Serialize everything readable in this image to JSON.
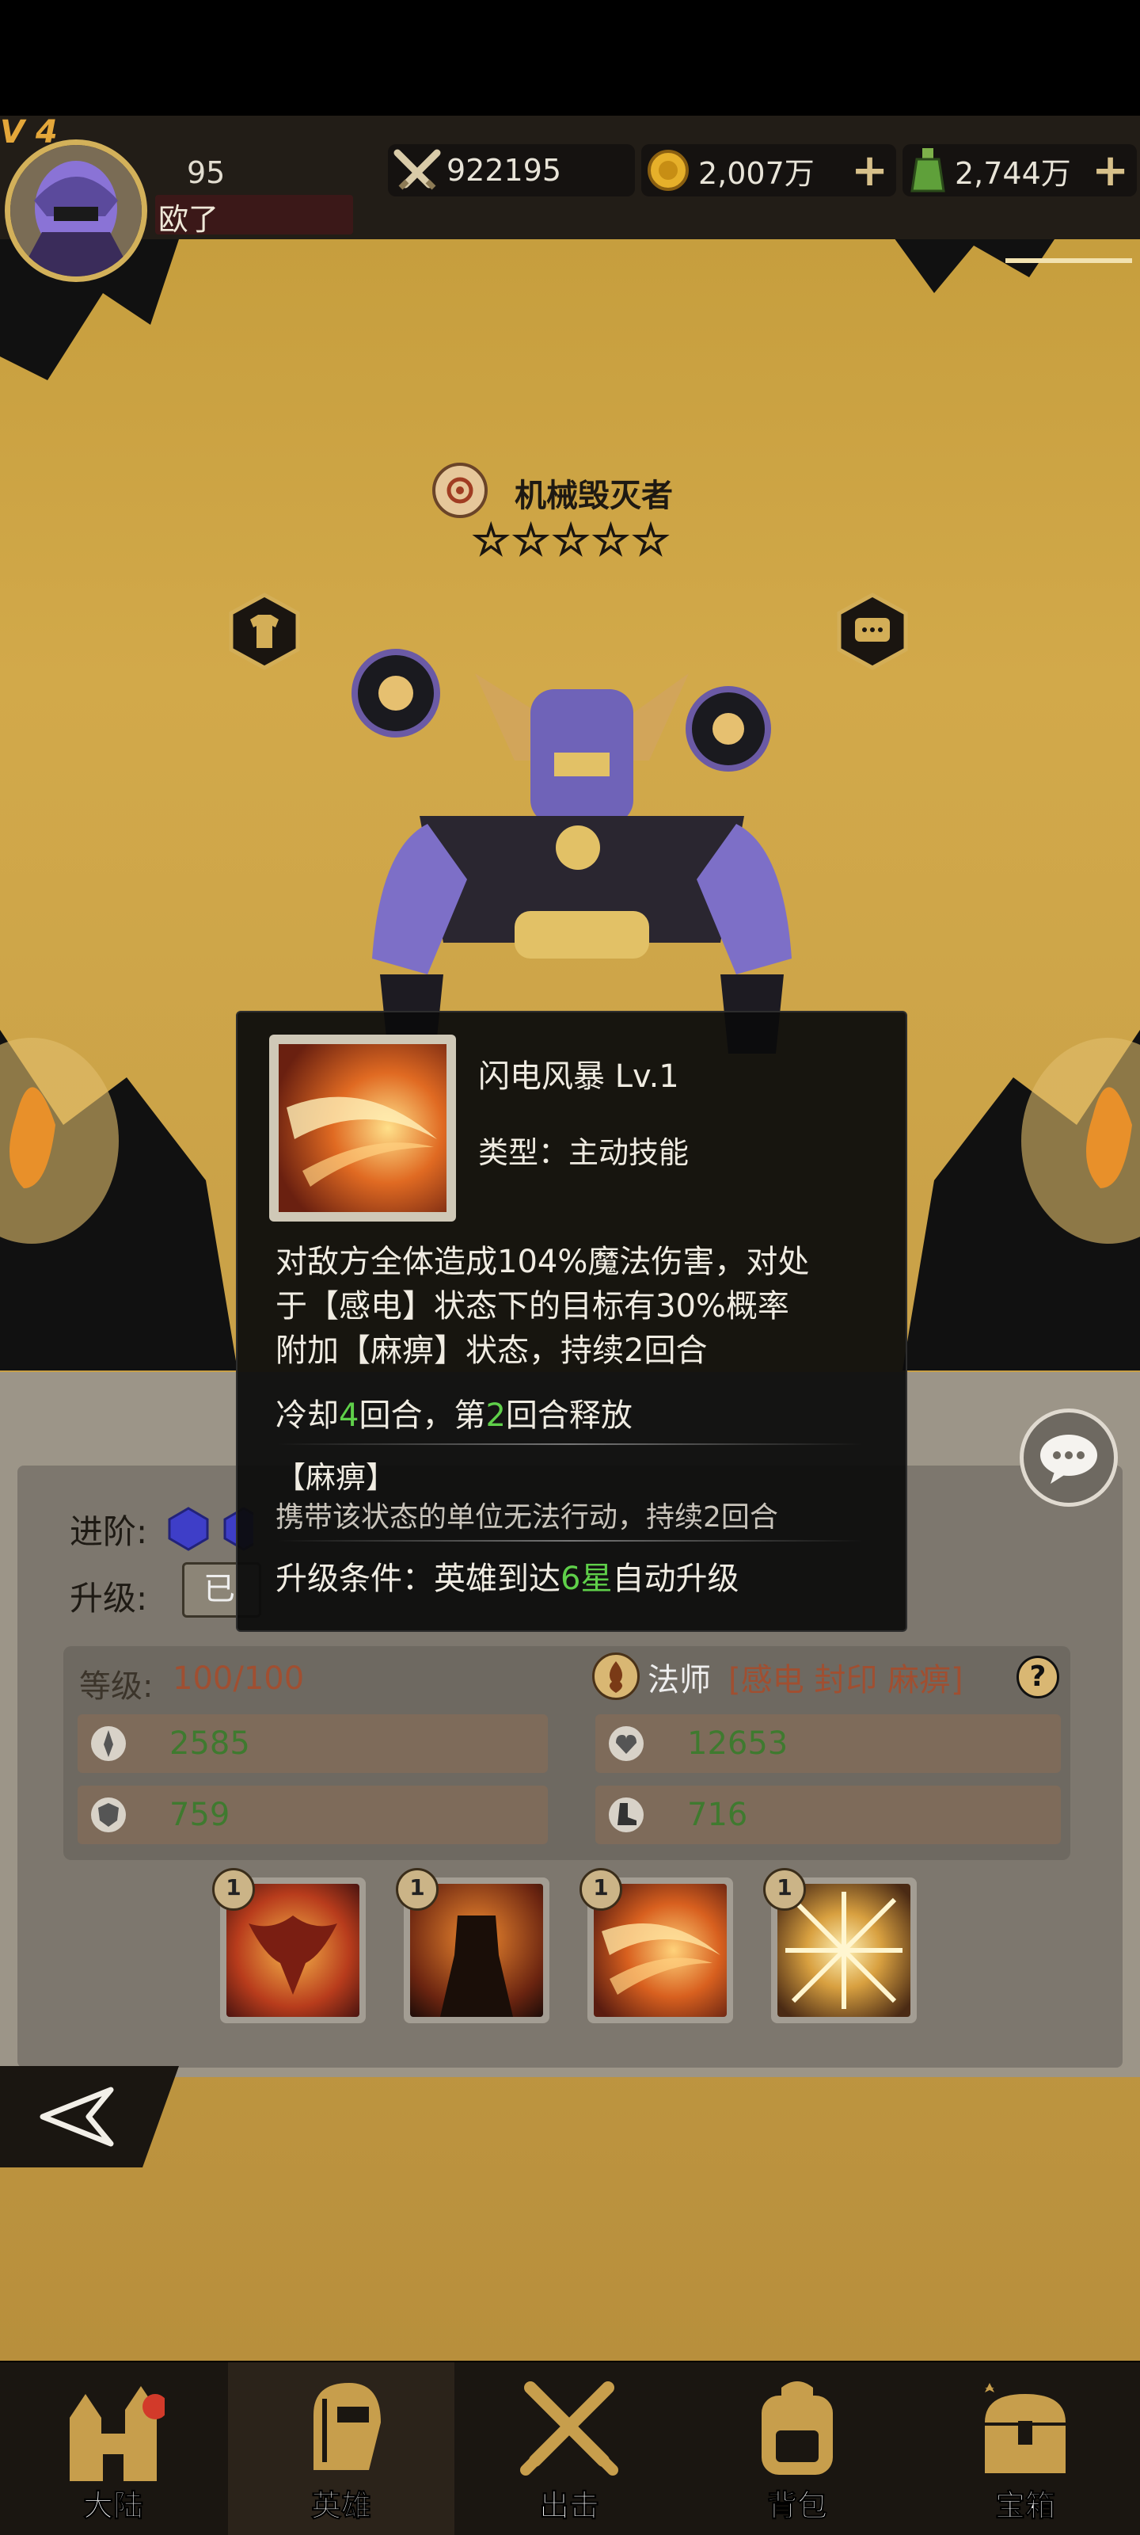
{
  "hud": {
    "level_tag": "V 4",
    "player_level": "95",
    "player_name": "欧了",
    "power": "922195",
    "gold": "2,007万",
    "potion": "2,744万"
  },
  "hero": {
    "name": "机械毁灭者",
    "stars": 5
  },
  "tooltip": {
    "skill_name": "闪电风暴 Lv.1",
    "type_label": "类型：主动技能",
    "desc_line1": "对敌方全体造成104%魔法伤害，对处",
    "desc_line2": "于【感电】状态下的目标有30%概率",
    "desc_line3": "附加【麻痹】状态，持续2回合",
    "cd_prefix": "冷却",
    "cd_turns": "4",
    "cd_mid": "回合，第",
    "cd_release": "2",
    "cd_suffix": "回合释放",
    "status_title": "【麻痹】",
    "status_desc": "携带该状态的单位无法行动，持续2回合",
    "upgrade_prefix": "升级条件：英雄到达",
    "upgrade_star": "6星",
    "upgrade_suffix": "自动升级"
  },
  "panel": {
    "advance_label": "进阶:",
    "upgrade_label": "升级:",
    "upgrade_button": "已",
    "level_label": "等级:",
    "level_value": "100/100",
    "class_label": "法师",
    "class_tags": "[感电 封印 麻痹]",
    "stats": {
      "attack": "2585",
      "hp": "12653",
      "defense": "759",
      "speed": "716"
    },
    "skills": [
      {
        "level": "1"
      },
      {
        "level": "1"
      },
      {
        "level": "1"
      },
      {
        "level": "1"
      }
    ]
  },
  "nav": [
    {
      "label": "大陆",
      "icon": "castle-icon"
    },
    {
      "label": "英雄",
      "icon": "helmet-icon"
    },
    {
      "label": "出击",
      "icon": "crossed-swords-icon"
    },
    {
      "label": "背包",
      "icon": "backpack-icon"
    },
    {
      "label": "宝箱",
      "icon": "treasure-chest-icon"
    }
  ],
  "colors": {
    "background": "#c9a14b",
    "highlight_green": "#5fd04a",
    "tag_brown": "#a04f31"
  }
}
